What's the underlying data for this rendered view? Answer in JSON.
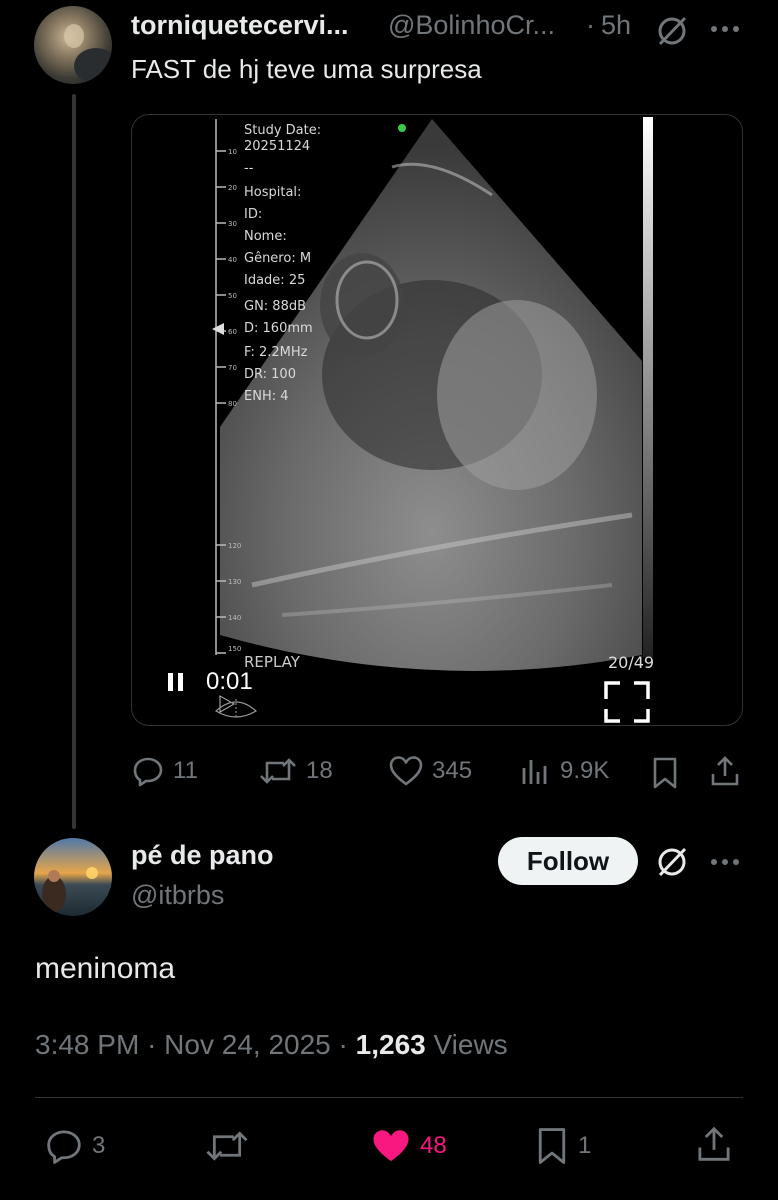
{
  "original_post": {
    "display_name": "torniquetecervi...",
    "handle": "@BolinhoCr...",
    "separator": "·",
    "time": "5h",
    "text": "FAST de hj teve uma surpresa",
    "video": {
      "overlay_lines": [
        "Study Date:",
        "20251124",
        "--",
        "Hospital:",
        "ID:",
        "Nome:",
        "Gênero: M",
        "Idade: 25",
        "GN: 88dB",
        "D: 160mm",
        "F: 2.2MHz",
        "DR: 100",
        "ENH: 4"
      ],
      "scale_ticks": [
        "10",
        "20",
        "30",
        "40",
        "50",
        "60",
        "70",
        "80",
        "120",
        "130",
        "140",
        "150"
      ],
      "replay_label": "REPLAY",
      "elapsed": "0:01",
      "frame": "20/49"
    },
    "stats": {
      "replies": "11",
      "reposts": "18",
      "likes": "345",
      "views": "9.9K"
    }
  },
  "reply_post": {
    "display_name": "pé de pano",
    "handle": "@itbrbs",
    "follow_label": "Follow",
    "text": "meninoma",
    "time": "3:48 PM",
    "date": "Nov 24, 2025",
    "views_count": "1,263",
    "views_label": "Views",
    "dot": "·",
    "stats": {
      "replies": "3",
      "likes": "48",
      "bookmarks": "1"
    }
  },
  "colors": {
    "background": "#000000",
    "text_primary": "#e7e9ea",
    "text_secondary": "#71767b",
    "like_active": "#f91880",
    "follow_bg": "#eff3f4"
  }
}
